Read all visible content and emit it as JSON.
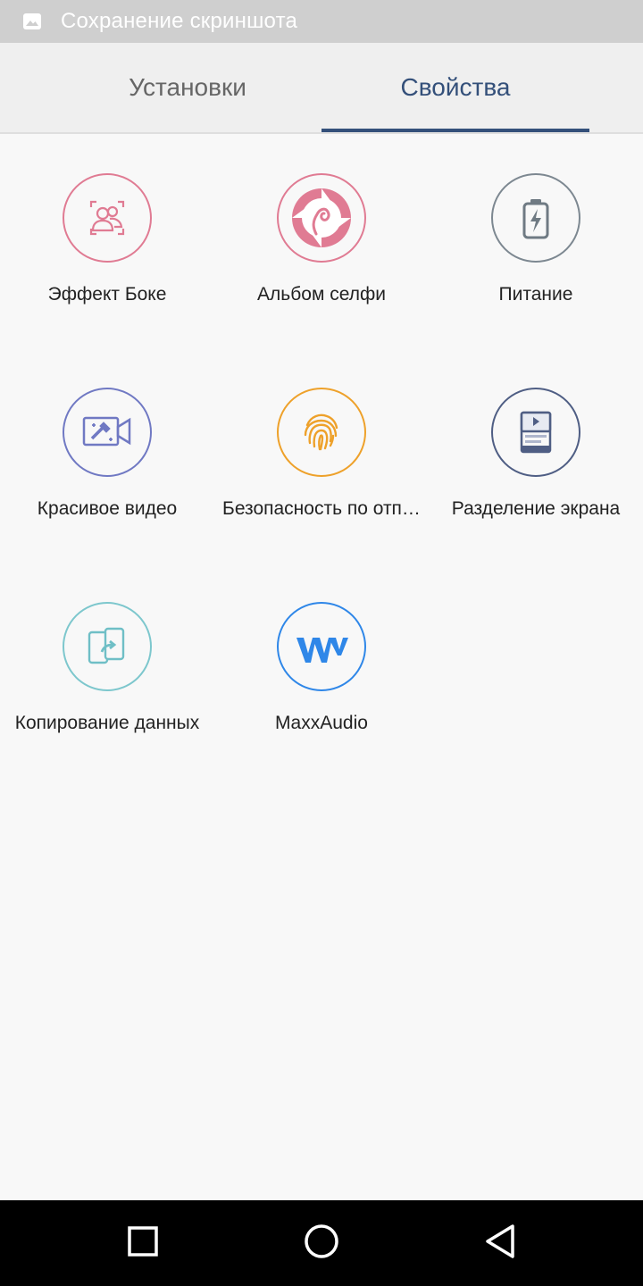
{
  "status_bar": {
    "icon": "image-icon",
    "text": "Сохранение скриншота"
  },
  "tabs": [
    {
      "label": "Установки",
      "selected": false
    },
    {
      "label": "Свойства",
      "selected": true
    }
  ],
  "features": [
    {
      "label": "Эффект Боке",
      "icon": "bokeh-portrait-icon",
      "color": "#e07b93"
    },
    {
      "label": "Альбом селфи",
      "icon": "selfie-album-icon",
      "color": "#e07b93"
    },
    {
      "label": "Питание",
      "icon": "battery-icon",
      "color": "#7d8891"
    },
    {
      "label": "Красивое видео",
      "icon": "beauty-video-icon",
      "color": "#7079c3"
    },
    {
      "label": "Безопасность по отп…",
      "icon": "fingerprint-icon",
      "color": "#eea12a"
    },
    {
      "label": "Разделение экрана",
      "icon": "split-screen-icon",
      "color": "#4f5e84"
    },
    {
      "label": "Копирование данных",
      "icon": "data-copy-icon",
      "color": "#7dc7cd"
    },
    {
      "label": "MaxxAudio",
      "icon": "maxxaudio-icon",
      "color": "#2f87e8"
    }
  ],
  "nav_bar": {
    "recents": "recents-icon",
    "home": "home-icon",
    "back": "back-icon"
  },
  "colors": {
    "accent": "#34507a",
    "status_bar_bg": "#cfcfcf",
    "tab_bar_bg": "#efefef",
    "content_bg": "#f8f8f8"
  }
}
